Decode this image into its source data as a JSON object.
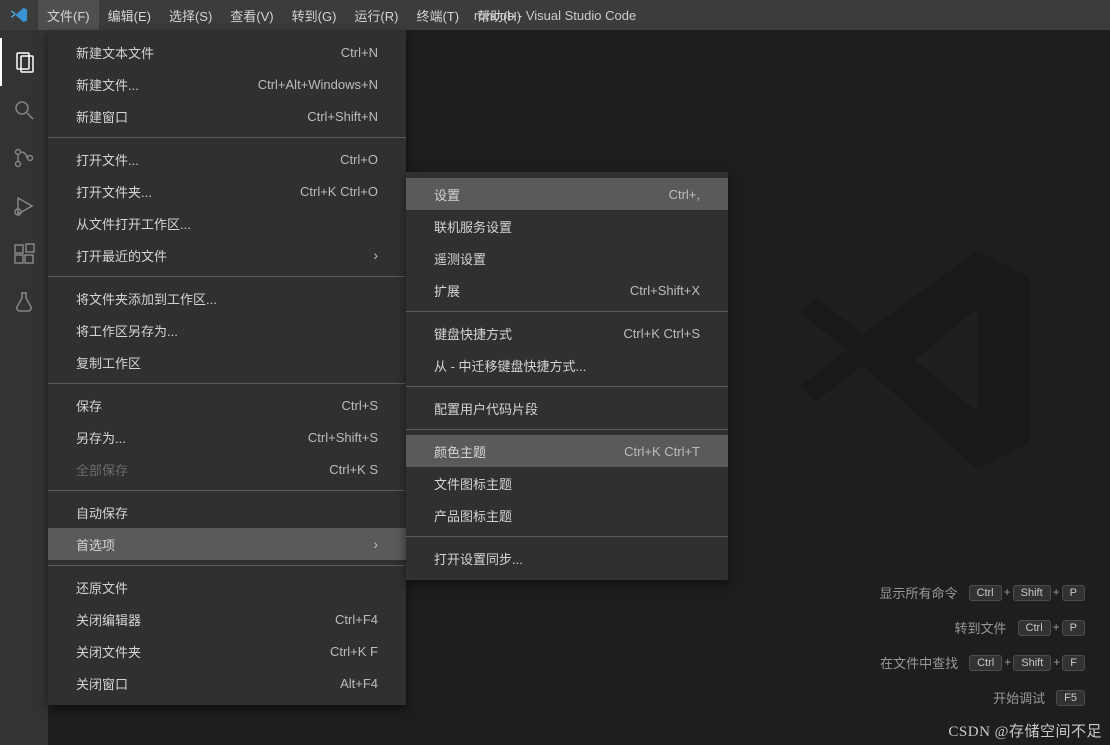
{
  "titlebar": {
    "title": "runoob - Visual Studio Code"
  },
  "menubar": {
    "items": [
      {
        "label": "文件(F)"
      },
      {
        "label": "编辑(E)"
      },
      {
        "label": "选择(S)"
      },
      {
        "label": "查看(V)"
      },
      {
        "label": "转到(G)"
      },
      {
        "label": "运行(R)"
      },
      {
        "label": "终端(T)"
      },
      {
        "label": "帮助(H)"
      }
    ]
  },
  "fileMenu": {
    "groups": [
      [
        {
          "label": "新建文本文件",
          "shortcut": "Ctrl+N"
        },
        {
          "label": "新建文件...",
          "shortcut": "Ctrl+Alt+Windows+N"
        },
        {
          "label": "新建窗口",
          "shortcut": "Ctrl+Shift+N"
        }
      ],
      [
        {
          "label": "打开文件...",
          "shortcut": "Ctrl+O"
        },
        {
          "label": "打开文件夹...",
          "shortcut": "Ctrl+K Ctrl+O"
        },
        {
          "label": "从文件打开工作区..."
        },
        {
          "label": "打开最近的文件",
          "submenu": true
        }
      ],
      [
        {
          "label": "将文件夹添加到工作区..."
        },
        {
          "label": "将工作区另存为..."
        },
        {
          "label": "复制工作区"
        }
      ],
      [
        {
          "label": "保存",
          "shortcut": "Ctrl+S"
        },
        {
          "label": "另存为...",
          "shortcut": "Ctrl+Shift+S"
        },
        {
          "label": "全部保存",
          "shortcut": "Ctrl+K S",
          "disabled": true
        }
      ],
      [
        {
          "label": "自动保存"
        },
        {
          "label": "首选项",
          "submenu": true,
          "hover": true
        }
      ],
      [
        {
          "label": "还原文件"
        },
        {
          "label": "关闭编辑器",
          "shortcut": "Ctrl+F4"
        },
        {
          "label": "关闭文件夹",
          "shortcut": "Ctrl+K F"
        },
        {
          "label": "关闭窗口",
          "shortcut": "Alt+F4"
        }
      ]
    ]
  },
  "prefMenu": {
    "groups": [
      [
        {
          "label": "设置",
          "shortcut": "Ctrl+,",
          "hover": true
        },
        {
          "label": "联机服务设置"
        },
        {
          "label": "遥测设置"
        },
        {
          "label": "扩展",
          "shortcut": "Ctrl+Shift+X"
        }
      ],
      [
        {
          "label": "键盘快捷方式",
          "shortcut": "Ctrl+K Ctrl+S"
        },
        {
          "label": "从 - 中迁移键盘快捷方式..."
        }
      ],
      [
        {
          "label": "配置用户代码片段"
        }
      ],
      [
        {
          "label": "颜色主题",
          "shortcut": "Ctrl+K Ctrl+T",
          "hover": true
        },
        {
          "label": "文件图标主题"
        },
        {
          "label": "产品图标主题"
        }
      ],
      [
        {
          "label": "打开设置同步..."
        }
      ]
    ]
  },
  "shortcuts": {
    "rows": [
      {
        "label": "显示所有命令",
        "keys": [
          "Ctrl",
          "Shift",
          "P"
        ]
      },
      {
        "label": "转到文件",
        "keys": [
          "Ctrl",
          "P"
        ]
      },
      {
        "label": "在文件中查找",
        "keys": [
          "Ctrl",
          "Shift",
          "F"
        ]
      },
      {
        "label": "开始调试",
        "keys": [
          "F5"
        ]
      }
    ]
  },
  "watermark": "CSDN @存储空间不足"
}
